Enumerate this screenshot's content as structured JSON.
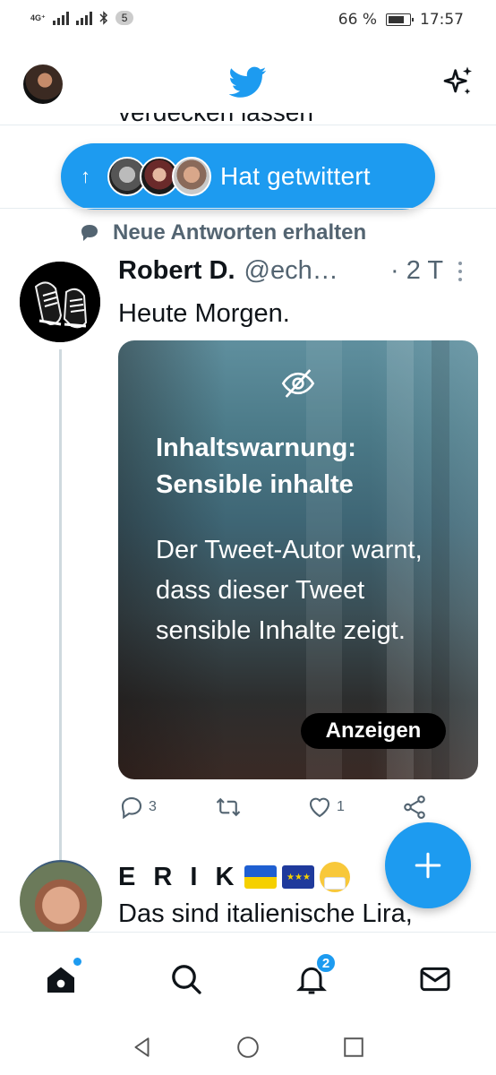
{
  "status_bar": {
    "network": "4G⁺",
    "notification_count": "5",
    "battery": "66 %",
    "time": "17:57"
  },
  "header": {
    "logo": "twitter-bird-icon",
    "right_icon": "sparkle-icon"
  },
  "timeline": {
    "cutoff_text": "verdecken lassen",
    "new_tweets_pill": {
      "arrow": "↑",
      "label": "Hat getwittert"
    },
    "reply_context": "Neue Antworten erhalten",
    "tweet": {
      "name": "Robert D.",
      "handle": "@ech…",
      "time": "· 2 T",
      "text": "Heute Morgen.",
      "content_warning": {
        "title": "Inhaltswarnung: Sensible inhalte",
        "body": "Der Tweet-Autor warnt, dass dieser Tweet sensible Inhalte zeigt.",
        "show_button": "Anzeigen"
      },
      "actions": {
        "replies": "3",
        "retweets": "",
        "likes": "1"
      }
    },
    "next_tweet": {
      "name": "E R I K",
      "text": "Das sind italienische Lira,"
    }
  },
  "compose_button": "+",
  "tab_bar": {
    "items": [
      "home-icon",
      "search-icon",
      "notifications-icon",
      "messages-icon"
    ],
    "notification_badge": "2"
  },
  "colors": {
    "brand": "#1d9bf0",
    "text": "#0f1419",
    "secondary": "#536471"
  }
}
